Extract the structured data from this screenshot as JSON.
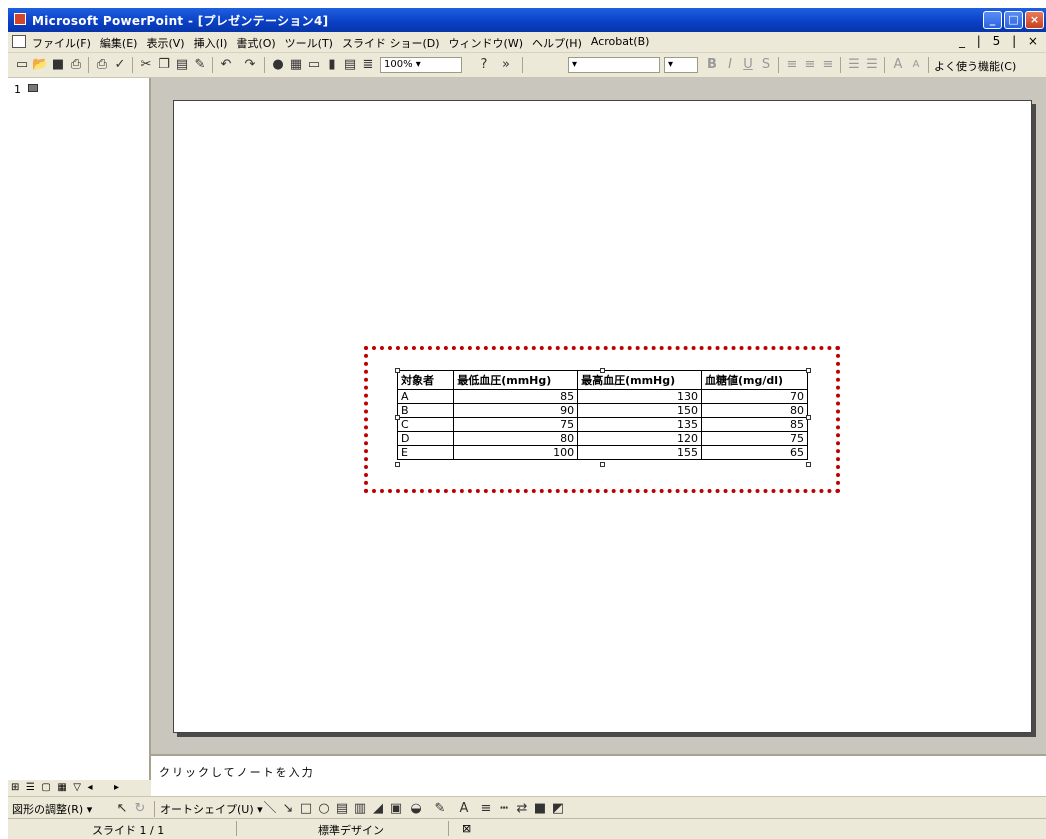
{
  "window": {
    "title": "Microsoft PowerPoint - [プレゼンテーション4]",
    "controls": [
      "_",
      "□",
      "×"
    ]
  },
  "menu": {
    "items": [
      "ファイル(F)",
      "編集(E)",
      "表示(V)",
      "挿入(I)",
      "書式(O)",
      "ツール(T)",
      "スライド ショー(D)",
      "ウィンドウ(W)",
      "ヘルプ(H)",
      "Acrobat(B)"
    ],
    "doc_controls": "_ | 5 | ×"
  },
  "toolbar": {
    "zoom": "100%",
    "frequent_functions": "よく使う機能(C)"
  },
  "left_panel": {
    "slide_number": "1"
  },
  "table": {
    "headers": [
      "対象者",
      "最低血圧(mmHg)",
      "最高血圧(mmHg)",
      "血糖値(mg/dl)"
    ],
    "rows": [
      [
        "A",
        "85",
        "130",
        "70"
      ],
      [
        "B",
        "90",
        "150",
        "80"
      ],
      [
        "C",
        "75",
        "135",
        "85"
      ],
      [
        "D",
        "80",
        "120",
        "75"
      ],
      [
        "E",
        "100",
        "155",
        "65"
      ]
    ]
  },
  "notes": {
    "placeholder": "クリックしてノートを入力"
  },
  "draw_toolbar": {
    "adjust_label": "図形の調整(R)",
    "autoshape_label": "オートシェイプ(U)"
  },
  "status": {
    "slide": "スライド 1 / 1",
    "design": "標準デザイン"
  },
  "colors": {
    "selection_border": "#c00000",
    "titlebar": "#0a3fc4",
    "chrome": "#ece9d8",
    "workspace": "#c9c6bd"
  }
}
